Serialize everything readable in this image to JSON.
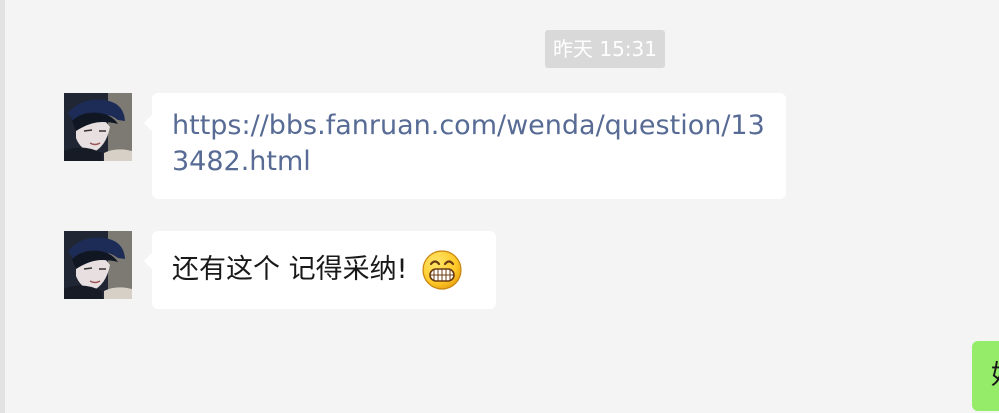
{
  "chat": {
    "timestamp": "昨天 15:31",
    "messages": [
      {
        "sender": "other",
        "type": "link",
        "text": "https://bbs.fanruan.com/wenda/question/133482.html"
      },
      {
        "sender": "other",
        "type": "text",
        "text": "还有这个 记得采纳!",
        "emoji_icon": "grinning-face-icon"
      },
      {
        "sender": "self",
        "type": "text",
        "text": "好"
      }
    ]
  },
  "colors": {
    "background": "#f4f4f4",
    "timestamp_bg": "#d9d9d9",
    "incoming_bubble": "#ffffff",
    "outgoing_bubble": "#95ec69",
    "link": "#576b95"
  }
}
